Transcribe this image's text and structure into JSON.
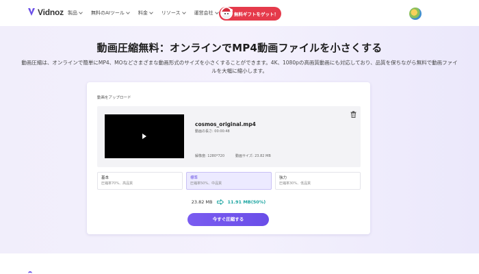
{
  "header": {
    "logo_text": "Vidnoz",
    "nav": [
      {
        "label": "製品"
      },
      {
        "label": "無料のAIツール"
      },
      {
        "label": "料金"
      },
      {
        "label": "リソース"
      },
      {
        "label": "運営会社"
      }
    ],
    "promo_label": "無料ギフトをゲット！"
  },
  "hero": {
    "title": "動画圧縮無料：オンラインでMP4動画ファイルを小さくする",
    "description": "動画圧縮は、オンラインで簡単にMP4、MOなどさまざまな動画形式のサイズを小さくすることができます。4K、1080pの高画質動画にも対応しており、品質を保ちながら無料で動画ファイルを大幅に縮小します。"
  },
  "uploader": {
    "label": "動画をアップロード",
    "file_name": "cosmos_original.mp4",
    "duration": "動画の長さ: 00:00:48",
    "resolution": "解像度: 1280*720",
    "size": "動画サイズ: 23.82 MB",
    "options": [
      {
        "title": "基本",
        "sub": "圧縮率70%、高品質",
        "selected": false
      },
      {
        "title": "標準",
        "sub": "圧縮率50%、中品質",
        "selected": true
      },
      {
        "title": "強力",
        "sub": "圧縮率30%、低品質",
        "selected": false
      }
    ],
    "original_size": "23.82 MB",
    "new_size": "11.91 MB(50%)",
    "compress_button": "今すぐ圧縮する"
  },
  "colors": {
    "accent": "#6a4ee8",
    "promo": "#e53a4b",
    "result": "#1aa4a0"
  }
}
